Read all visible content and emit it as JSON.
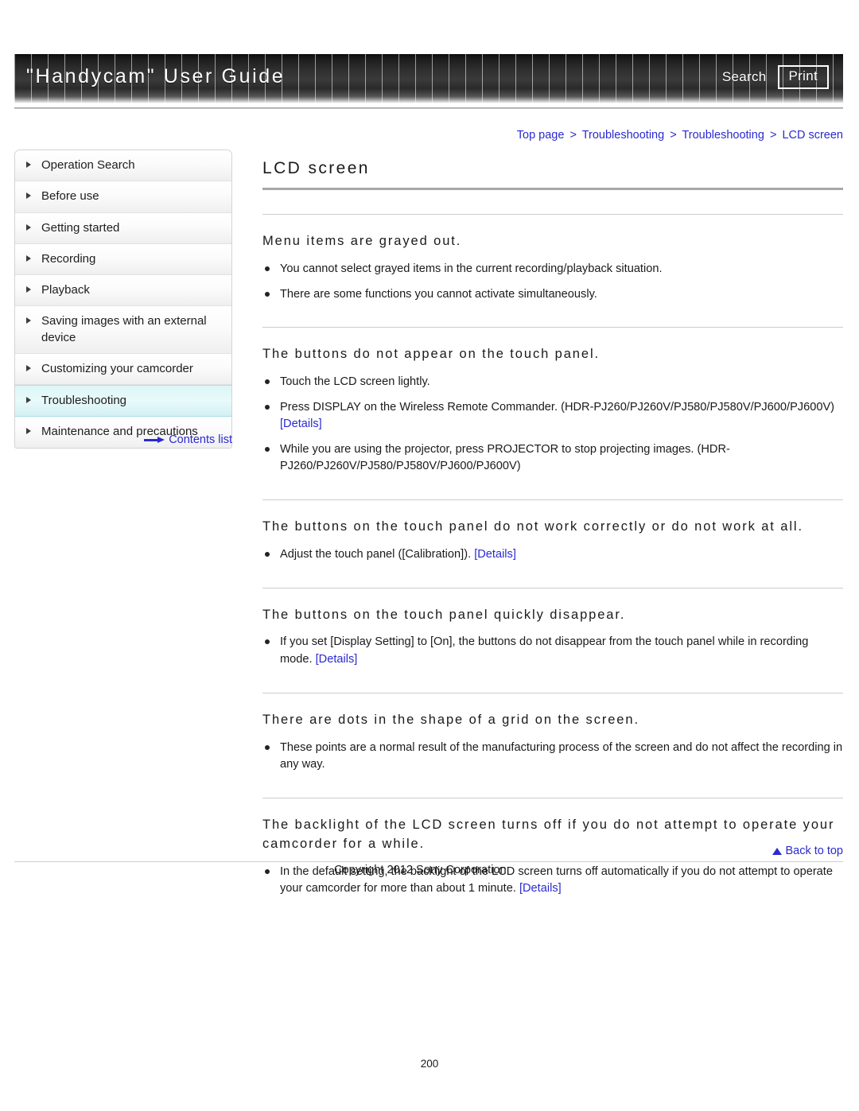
{
  "header": {
    "title": "\"Handycam\" User Guide",
    "search_label": "Search",
    "print_label": "Print"
  },
  "breadcrumb": {
    "separator": ">",
    "items": [
      {
        "label": "Top page"
      },
      {
        "label": "Troubleshooting"
      },
      {
        "label": "Troubleshooting"
      },
      {
        "label": "LCD screen"
      }
    ]
  },
  "sidebar": {
    "items": [
      {
        "label": "Operation Search",
        "active": false
      },
      {
        "label": "Before use",
        "active": false
      },
      {
        "label": "Getting started",
        "active": false
      },
      {
        "label": "Recording",
        "active": false
      },
      {
        "label": "Playback",
        "active": false
      },
      {
        "label": "Saving images with an external device",
        "active": false
      },
      {
        "label": "Customizing your camcorder",
        "active": false
      },
      {
        "label": "Troubleshooting",
        "active": true
      },
      {
        "label": "Maintenance and precautions",
        "active": false
      }
    ],
    "contents_list_label": "Contents list"
  },
  "main": {
    "page_title": "LCD screen",
    "sections": [
      {
        "heading": "Menu items are grayed out.",
        "bullets": [
          {
            "text": "You cannot select grayed items in the current recording/playback situation."
          },
          {
            "text": "There are some functions you cannot activate simultaneously."
          }
        ]
      },
      {
        "heading": "The buttons do not appear on the touch panel.",
        "bullets": [
          {
            "text": "Touch the LCD screen lightly."
          },
          {
            "text": "Press DISPLAY on the Wireless Remote Commander. (HDR-PJ260/PJ260V/PJ580/PJ580V/PJ600/PJ600V) ",
            "link": "[Details]"
          },
          {
            "text": "While you are using the projector, press PROJECTOR to stop projecting images. (HDR-PJ260/PJ260V/PJ580/PJ580V/PJ600/PJ600V)"
          }
        ]
      },
      {
        "heading": "The buttons on the touch panel do not work correctly or do not work at all.",
        "bullets": [
          {
            "text": "Adjust the touch panel ([Calibration]). ",
            "link": "[Details]"
          }
        ]
      },
      {
        "heading": "The buttons on the touch panel quickly disappear.",
        "bullets": [
          {
            "text": "If you set [Display Setting] to [On], the buttons do not disappear from the touch panel while in recording mode. ",
            "link": "[Details]"
          }
        ]
      },
      {
        "heading": "There are dots in the shape of a grid on the screen.",
        "bullets": [
          {
            "text": "These points are a normal result of the manufacturing process of the screen and do not affect the recording in any way."
          }
        ]
      },
      {
        "heading": "The backlight of the LCD screen turns off if you do not attempt to operate your camcorder for a while.",
        "bullets": [
          {
            "text": "In the default setting, the backlight of the LCD screen turns off automatically if you do not attempt to operate your camcorder for more than about 1 minute. ",
            "link": "[Details]"
          }
        ]
      }
    ]
  },
  "footer": {
    "back_to_top_label": "Back to top",
    "copyright": "Copyright 2012 Sony Corporation",
    "page_number": "200"
  },
  "colors": {
    "link": "#2a2ad0",
    "active_nav_bg": "#ddf5f7",
    "header_dark": "#2e2e2e"
  }
}
